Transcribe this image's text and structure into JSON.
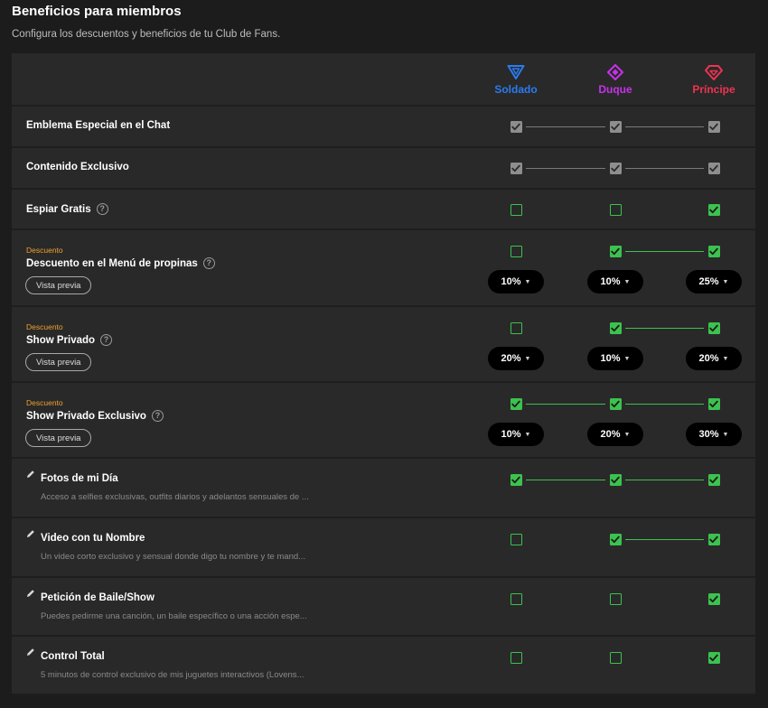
{
  "header": {
    "title": "Beneficios para miembros",
    "subtitle": "Configura los descuentos y beneficios de tu Club de Fans."
  },
  "tiers": [
    {
      "name": "Soldado",
      "color": "#2a7bf0",
      "icon": "triangle-icon"
    },
    {
      "name": "Duque",
      "color": "#c632e8",
      "icon": "diamond-icon"
    },
    {
      "name": "Príncipe",
      "color": "#ef3352",
      "icon": "gem-icon"
    }
  ],
  "labels": {
    "discount_tag": "Descuento",
    "preview_button": "Vista previa"
  },
  "rows": [
    {
      "label": "Emblema Especial en el Chat",
      "help": false,
      "states": [
        "locked",
        "locked",
        "locked"
      ]
    },
    {
      "label": "Contenido Exclusivo",
      "help": false,
      "states": [
        "locked",
        "locked",
        "locked"
      ]
    },
    {
      "label": "Espiar Gratis",
      "help": true,
      "states": [
        "off",
        "off",
        "on"
      ]
    },
    {
      "label": "Descuento en el Menú de propinas",
      "help": true,
      "discount": true,
      "states": [
        "off",
        "on",
        "on"
      ],
      "percents": [
        "10%",
        "10%",
        "25%"
      ]
    },
    {
      "label": "Show Privado",
      "help": true,
      "discount": true,
      "states": [
        "off",
        "on",
        "on"
      ],
      "percents": [
        "20%",
        "10%",
        "20%"
      ]
    },
    {
      "label": "Show Privado Exclusivo",
      "help": true,
      "discount": true,
      "states": [
        "on",
        "on",
        "on"
      ],
      "percents": [
        "10%",
        "20%",
        "30%"
      ]
    },
    {
      "label": "Fotos de mi Día",
      "custom": true,
      "description": "Acceso a selfies exclusivas, outfits diarios y adelantos sensuales de ...",
      "states": [
        "on",
        "on",
        "on"
      ]
    },
    {
      "label": "Video con tu Nombre",
      "custom": true,
      "description": "Un video corto exclusivo y sensual donde digo tu nombre y te mand...",
      "states": [
        "off",
        "on",
        "on"
      ]
    },
    {
      "label": "Petición de Baile/Show",
      "custom": true,
      "description": "Puedes pedirme una canción, un baile específico o una acción espe...",
      "states": [
        "off",
        "off",
        "on"
      ]
    },
    {
      "label": "Control Total",
      "custom": true,
      "description": "5 minutos de control exclusivo de mis juguetes interactivos (Lovens...",
      "states": [
        "off",
        "off",
        "on"
      ]
    }
  ]
}
